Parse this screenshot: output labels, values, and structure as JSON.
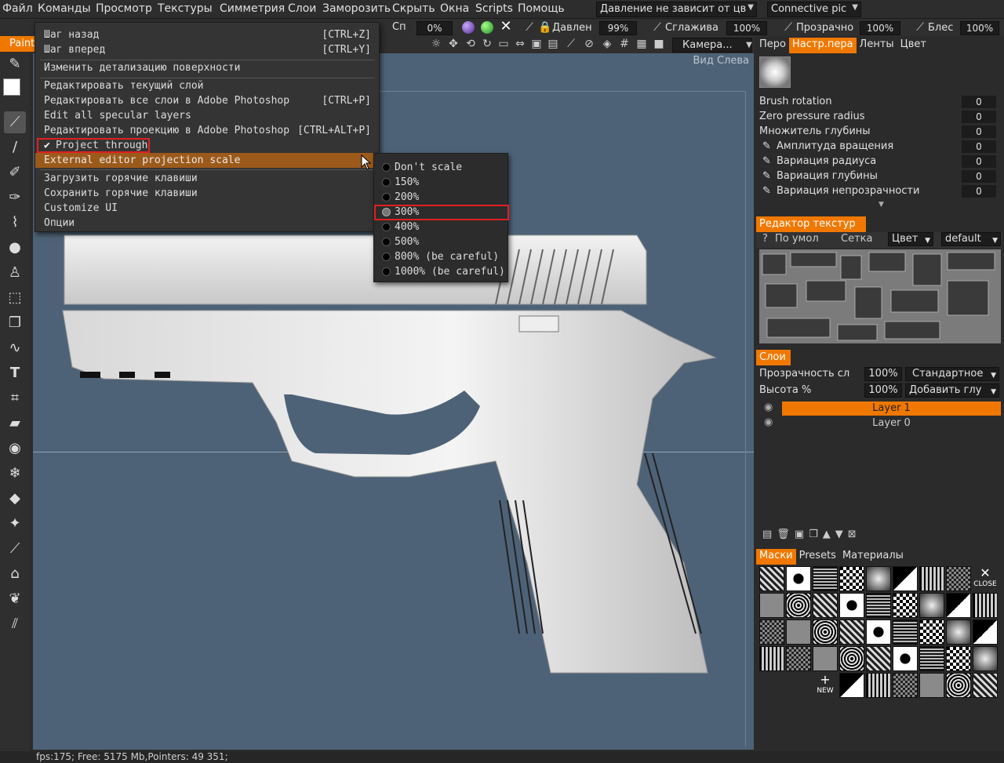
{
  "menubar": {
    "items": [
      "Файл",
      "Команды",
      "Просмотр",
      "Текстуры",
      "Симметрия",
      "Слои",
      "Заморозить",
      "Скрыть",
      "Окна",
      "Scripts",
      "Помощь"
    ],
    "pressure_combo": "Давление не зависит от цв",
    "connective_combo": "Connective pic"
  },
  "toolbar": {
    "left_tab": "Paint",
    "sp_label": "Сп",
    "sp_value": "0%",
    "pressure_label": "Давлен",
    "pressure_value": "99%",
    "smooth_label": "Сглажива",
    "smooth_value": "100%",
    "opacity_label": "Прозрачно",
    "opacity_value": "100%",
    "gloss_label": "Блес",
    "gloss_value": "100%",
    "camera_label": "Камера..."
  },
  "viewport": {
    "view_label": "Вид Слева"
  },
  "mainmenu": {
    "items": [
      {
        "label": "Шаг назад",
        "shortcut": "[CTRL+Z]"
      },
      {
        "label": "Шаг вперед",
        "shortcut": "[CTRL+Y]"
      },
      {
        "label": "Изменить детализацию поверхности",
        "shortcut": ""
      },
      {
        "label": "Редактировать текущий слой",
        "shortcut": ""
      },
      {
        "label": "Редактировать все слои в Adobe Photoshop",
        "shortcut": "[CTRL+P]"
      },
      {
        "label": "Edit all specular layers",
        "shortcut": ""
      },
      {
        "label": "Редактировать проекцию в Adobe Photoshop",
        "shortcut": "[CTRL+ALT+P]"
      },
      {
        "label": "Project through",
        "shortcut": ""
      },
      {
        "label": "External editor projection scale",
        "shortcut": ""
      },
      {
        "label": "Загрузить горячие клавиши",
        "shortcut": ""
      },
      {
        "label": "Сохранить горячие клавиши",
        "shortcut": ""
      },
      {
        "label": "Customize UI",
        "shortcut": ""
      },
      {
        "label": "Опции",
        "shortcut": ""
      }
    ],
    "project_through_checked": true
  },
  "submenu": {
    "options": [
      "Don't scale",
      "150%",
      "200%",
      "300%",
      "400%",
      "500%",
      "800% (be careful)",
      "1000% (be careful)"
    ],
    "selected": "300%"
  },
  "brush_panel": {
    "tabs": [
      "Перо",
      "Настр.пера",
      "Ленты",
      "Цвет"
    ],
    "active_tab": "Настр.пера",
    "params": [
      {
        "label": "Brush rotation",
        "value": "0"
      },
      {
        "label": "Zero pressure radius",
        "value": "0"
      },
      {
        "label": "Множитель глубины",
        "value": "0"
      },
      {
        "label": "Амплитуда вращения",
        "value": "0"
      },
      {
        "label": "Вариация радиуса",
        "value": "0"
      },
      {
        "label": "Вариация глубины",
        "value": "0"
      },
      {
        "label": "Вариация непрозрачности",
        "value": "0"
      }
    ]
  },
  "texture_editor": {
    "title": "Редактор текстур",
    "help": "?",
    "default_label": "По умол",
    "grid_label": "Сетка",
    "color_combo": "Цвет",
    "default_combo": "default"
  },
  "layers": {
    "title": "Слои",
    "opacity_label": "Прозрачность сл",
    "opacity_value": "100%",
    "blend_mode": "Стандартное",
    "height_label": "Высота %",
    "height_value": "100%",
    "add_combo": "Добавить глу",
    "items": [
      {
        "name": "Layer 1",
        "active": true
      },
      {
        "name": "Layer 0",
        "active": false
      }
    ]
  },
  "masks": {
    "tabs": [
      "Маски",
      "Presets",
      "Материалы"
    ],
    "active_tab": "Маски",
    "close_label": "CLOSE",
    "new_label": "NEW"
  },
  "status": {
    "text": "fps:175;    Free: 5175 Mb,Pointers: 49 351;"
  },
  "colors": {
    "accent": "#f07800",
    "viewport_bg": "#4e6277",
    "highlight_box": "#e02020"
  }
}
